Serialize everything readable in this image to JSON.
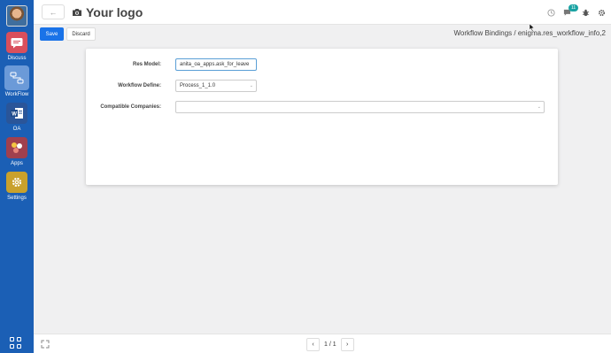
{
  "sidebar": {
    "apps": [
      {
        "label": "Discuss",
        "icon": "chat-icon",
        "color": "#d94f5c"
      },
      {
        "label": "WorkFlow",
        "icon": "workflow-icon",
        "color": "#5b8fd4",
        "active": true
      },
      {
        "label": "OA",
        "icon": "word-icon",
        "color": "#2a5599"
      },
      {
        "label": "Apps",
        "icon": "apps-icon",
        "color": "#a0404e"
      },
      {
        "label": "Settings",
        "icon": "gear-icon",
        "color": "#c9a12c"
      }
    ]
  },
  "topbar": {
    "logo_text": "Your logo",
    "message_count": "11"
  },
  "control": {
    "save_label": "Save",
    "discard_label": "Discard",
    "breadcrumb": "Workflow Bindings / enigma.res_workflow_info,2"
  },
  "form": {
    "res_model_label": "Res Model:",
    "res_model_value": "anita_oa_apps.ask_for_leave",
    "workflow_define_label": "Workflow Define:",
    "workflow_define_value": "Process_1_1.0",
    "compatible_companies_label": "Compatible Companies:",
    "compatible_companies_value": ""
  },
  "pager": {
    "value": "1 / 1"
  },
  "colors": {
    "sidebar": "#1b5fb5",
    "primary": "#1a73e8",
    "badge": "#1aa3a3"
  }
}
